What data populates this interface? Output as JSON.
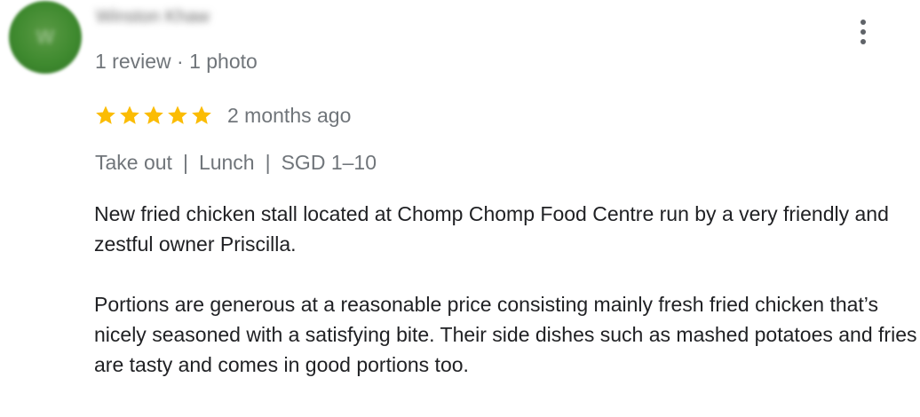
{
  "reviewer": {
    "name": "Winston Khaw",
    "meta": "1 review · 1 photo",
    "avatar_color": "#3f8a2f"
  },
  "menu": {
    "icon": "more-vert-icon"
  },
  "rating": {
    "stars": 5,
    "max_stars": 5,
    "star_color": "#fbbc04",
    "date": "2 months ago"
  },
  "attributes": {
    "service": "Take out",
    "meal": "Lunch",
    "price": "SGD 1–10",
    "separator": "|"
  },
  "body": {
    "paragraph1": "New fried chicken stall located at Chomp Chomp Food Centre run by a very friendly and zestful owner Priscilla.",
    "paragraph2": "Portions are generous at a reasonable price consisting mainly fresh fried chicken that’s nicely seasoned with a satisfying bite. Their side dishes such as mashed potatoes and fries are tasty and comes in good portions too."
  }
}
